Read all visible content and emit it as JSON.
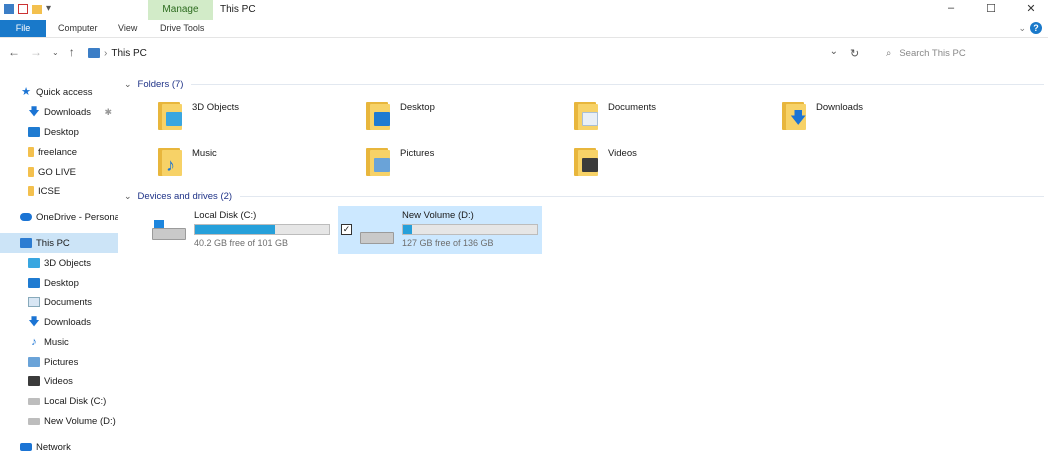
{
  "window": {
    "title": "This PC",
    "manage_tab": "Manage",
    "controls": [
      "–",
      "☐",
      "✕"
    ]
  },
  "ribbon": {
    "tabs": [
      "File",
      "Computer",
      "View",
      "Drive Tools"
    ]
  },
  "address": {
    "path": "This PC",
    "search_placeholder": "Search This PC"
  },
  "sidebar": {
    "items": [
      {
        "label": "Quick access",
        "icon": "star-icon"
      },
      {
        "label": "Downloads",
        "icon": "download-icon",
        "pinned": true
      },
      {
        "label": "Desktop",
        "icon": "desktop-icon"
      },
      {
        "label": "freelance",
        "icon": "folder-icon"
      },
      {
        "label": "GO LIVE",
        "icon": "folder-icon"
      },
      {
        "label": "ICSE",
        "icon": "folder-icon"
      },
      {
        "label": "OneDrive - Personal",
        "icon": "onedrive-icon"
      },
      {
        "label": "This PC",
        "icon": "pc-icon",
        "selected": true
      },
      {
        "label": "3D Objects",
        "icon": "cube-icon"
      },
      {
        "label": "Desktop",
        "icon": "desktop-icon"
      },
      {
        "label": "Documents",
        "icon": "document-icon"
      },
      {
        "label": "Downloads",
        "icon": "download-icon"
      },
      {
        "label": "Music",
        "icon": "music-icon"
      },
      {
        "label": "Pictures",
        "icon": "picture-icon"
      },
      {
        "label": "Videos",
        "icon": "video-icon"
      },
      {
        "label": "Local Disk (C:)",
        "icon": "drive-icon"
      },
      {
        "label": "New Volume (D:)",
        "icon": "drive-icon"
      },
      {
        "label": "Network",
        "icon": "network-icon"
      }
    ]
  },
  "folders": {
    "header": "Folders (7)",
    "items": [
      {
        "label": "3D Objects",
        "icon": "3d-objects-folder-icon"
      },
      {
        "label": "Desktop",
        "icon": "desktop-folder-icon"
      },
      {
        "label": "Documents",
        "icon": "documents-folder-icon"
      },
      {
        "label": "Downloads",
        "icon": "downloads-folder-icon"
      },
      {
        "label": "Music",
        "icon": "music-folder-icon"
      },
      {
        "label": "Pictures",
        "icon": "pictures-folder-icon"
      },
      {
        "label": "Videos",
        "icon": "videos-folder-icon"
      }
    ]
  },
  "drives": {
    "header": "Devices and drives (2)",
    "items": [
      {
        "label": "Local Disk (C:)",
        "free_text": "40.2 GB free of 101 GB",
        "used_fraction": 0.6,
        "selected": false
      },
      {
        "label": "New Volume (D:)",
        "free_text": "127 GB free of 136 GB",
        "used_fraction": 0.07,
        "selected": true
      }
    ]
  },
  "colors": {
    "accent": "#1979ca",
    "selection": "#cce8ff",
    "manage_tab_bg": "#d2ebc8",
    "drive_bar_fill": "#26a0da"
  }
}
